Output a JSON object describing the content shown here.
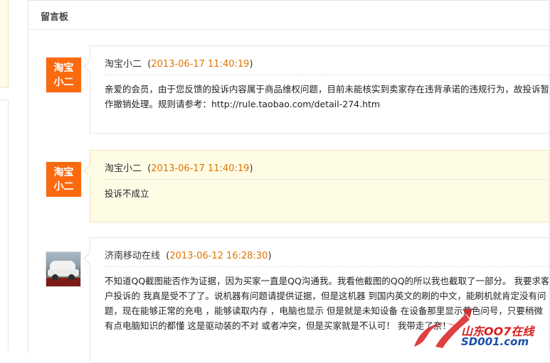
{
  "board": {
    "title": "留言板"
  },
  "messages": [
    {
      "author": "淘宝小二",
      "time": "2013-06-17 11:40:19",
      "avatar": {
        "type": "logo",
        "line1": "淘宝",
        "line2": "小二"
      },
      "body": "亲爱的会员，由于您反馈的投诉内容属于商品维权问题，目前未能核实到卖家存在违背承诺的违规行为，故投诉暂作撤销处理。规则请参考：http://rule.taobao.com/detail-274.htm",
      "highlighted": false
    },
    {
      "author": "淘宝小二",
      "time": "2013-06-17 11:40:19",
      "avatar": {
        "type": "logo",
        "line1": "淘宝",
        "line2": "小二"
      },
      "body": "投诉不成立",
      "highlighted": true
    },
    {
      "author": "济南移动在线",
      "time": "2013-06-12 16:28:30",
      "avatar": {
        "type": "photo"
      },
      "body": "不知道QQ截图能否作为证据，因为买家一直是QQ沟通我。我看他截图的QQ的所以我也截取了一部分。 我要求客户投诉的 我真是受不了了。说机器有问题请提供证据，但是这机器 到国内英文的刷的中文，能刷机就肯定没有问题，现在能够正常的充电 ，能够读取内存 ，电脑也显示 但是就是未知设备 在设备那里显示黄色问号，只要稍微有点电脑知识的都懂 这是驱动装的不对 或者冲突，但是买家就是不认可！ 我带走了奈！",
      "highlighted": false
    }
  ],
  "watermark": {
    "name": "山东OO7在线",
    "url": "SD001.com"
  },
  "colors": {
    "accent_time": "#e07400",
    "avatar_bg": "#fc6a0f",
    "highlight_bg": "#fffce6"
  }
}
